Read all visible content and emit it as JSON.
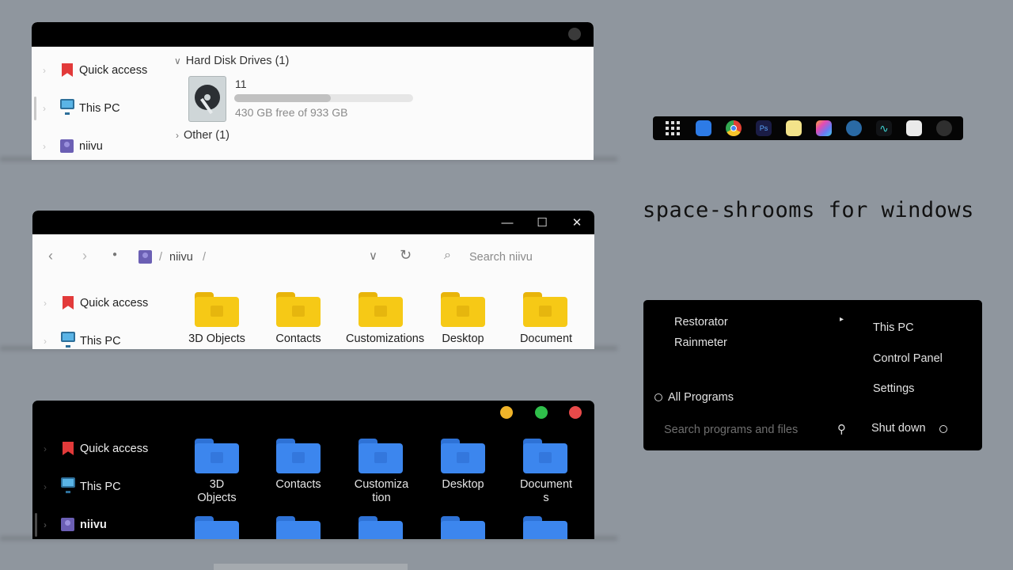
{
  "colors": {
    "background": "#8f969e",
    "yellow_dot": "#f0b429",
    "green_dot": "#2fbf4a",
    "red_dot": "#e84a4a",
    "folder_yellow": "#f6c916",
    "folder_blue": "#3c86ee"
  },
  "window1": {
    "nav": [
      {
        "label": "Quick access",
        "icon": "bookmark-icon"
      },
      {
        "label": "This PC",
        "icon": "monitor-icon"
      },
      {
        "label": "niivu",
        "icon": "user-icon"
      }
    ],
    "section_drives": "Hard Disk Drives (1)",
    "drive": {
      "name": "11",
      "free": "430 GB free of 933 GB",
      "used_fraction": 0.54
    },
    "section_other": "Other (1)"
  },
  "window2": {
    "controls": {
      "minimize": "—",
      "maximize": "☐",
      "close": "✕"
    },
    "breadcrumb": {
      "sep1": "/",
      "folder": "niivu",
      "sep2": "/"
    },
    "search_placeholder": "Search niivu",
    "nav": [
      {
        "label": "Quick access",
        "icon": "bookmark-icon"
      },
      {
        "label": "This PC",
        "icon": "monitor-icon"
      }
    ],
    "folders": [
      {
        "label": "3D Objects"
      },
      {
        "label": "Contacts"
      },
      {
        "label": "Customizations"
      },
      {
        "label": "Desktop"
      },
      {
        "label": "Document"
      }
    ]
  },
  "window3": {
    "nav": [
      {
        "label": "Quick access",
        "icon": "bookmark-icon"
      },
      {
        "label": "This PC",
        "icon": "monitor-icon"
      },
      {
        "label": "niivu",
        "icon": "user-icon"
      }
    ],
    "folders": [
      {
        "line1": "3D",
        "line2": "Objects"
      },
      {
        "line1": "Contacts",
        "line2": ""
      },
      {
        "line1": "Customiza",
        "line2": "tion"
      },
      {
        "line1": "Desktop",
        "line2": ""
      },
      {
        "line1": "Document",
        "line2": "s"
      }
    ]
  },
  "dock": {
    "icons": [
      "apps-grid-icon",
      "finder-icon",
      "chrome-icon",
      "photoshop-icon",
      "notes-icon",
      "gallery-icon",
      "steam-icon",
      "activity-icon",
      "launchpad-icon",
      "mask-icon"
    ],
    "photoshop_text": "Ps"
  },
  "brand_title": "space-shrooms for windows",
  "start_menu": {
    "recent": [
      "Restorator",
      "Rainmeter"
    ],
    "all_programs": "All Programs",
    "search_placeholder": "Search programs and files",
    "right_items": [
      "This PC",
      "Control Panel",
      "Settings"
    ],
    "shutdown": "Shut down"
  }
}
